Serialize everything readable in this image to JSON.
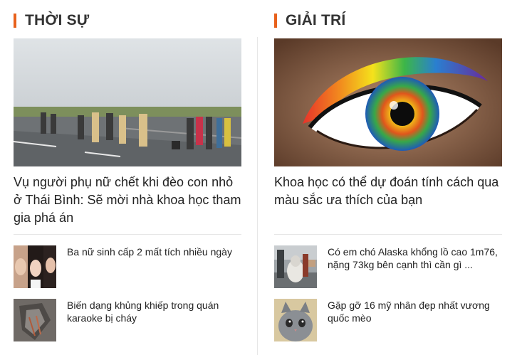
{
  "left": {
    "section_title": "THỜI SỰ",
    "hero_title": "Vụ người phụ nữ chết khi đèo con nhỏ ở Thái Bình: Sẽ mời nhà khoa học tham gia phá án",
    "items": [
      {
        "title": "Ba nữ sinh cấp 2 mất tích nhiều ngày"
      },
      {
        "title": "Biến dạng khủng khiếp trong quán karaoke bị cháy"
      }
    ]
  },
  "right": {
    "section_title": "GIẢI TRÍ",
    "hero_title": "Khoa học có thể dự đoán tính cách qua màu sắc ưa thích của bạn",
    "items": [
      {
        "title": "Có em chó Alaska khổng lồ cao 1m76, nặng 73kg bên cạnh thì cần gì ..."
      },
      {
        "title": "Gặp gỡ 16 mỹ nhân đẹp nhất vương quốc mèo"
      }
    ]
  },
  "colors": {
    "accent": "#e8611c"
  }
}
